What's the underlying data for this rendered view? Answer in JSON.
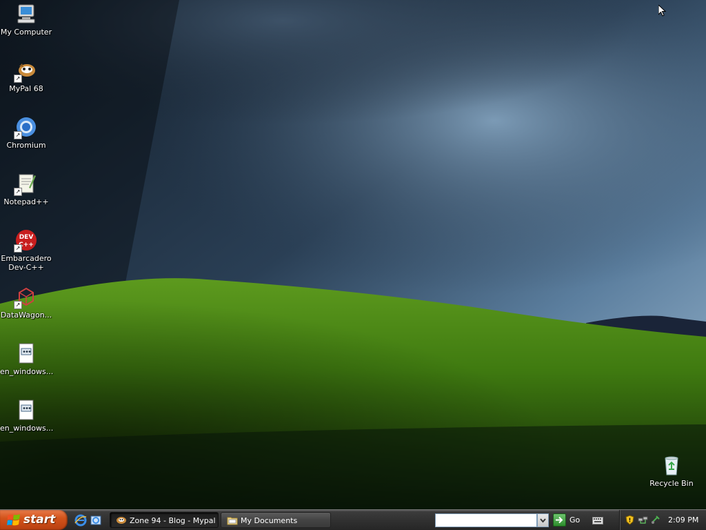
{
  "desktop": {
    "icons": [
      {
        "label": "My Computer",
        "icon": "my-computer-icon",
        "shortcut": false
      },
      {
        "label": "MyPal 68",
        "icon": "mypal-icon",
        "shortcut": true
      },
      {
        "label": "Chromium",
        "icon": "chromium-icon",
        "shortcut": true
      },
      {
        "label": "Notepad++",
        "icon": "notepad-plus-plus-icon",
        "shortcut": true
      },
      {
        "label": "Embarcadero Dev-C++",
        "icon": "dev-cpp-icon",
        "shortcut": true
      },
      {
        "label": "DataWagon...",
        "icon": "datawagon-icon",
        "shortcut": true
      },
      {
        "label": "en_windows...",
        "icon": "iso-file-icon",
        "shortcut": false
      },
      {
        "label": "en_windows...",
        "icon": "iso-file-icon",
        "shortcut": false
      },
      {
        "label": "Recycle Bin",
        "icon": "recycle-bin-icon",
        "shortcut": false
      }
    ]
  },
  "taskbar": {
    "start_label": "start",
    "quick_launch": [
      "internet-explorer-icon",
      "show-desktop-icon"
    ],
    "tasks": [
      {
        "label": "Zone 94 - Blog - Mypal",
        "icon": "mypal-icon",
        "active": true
      },
      {
        "label": "My Documents",
        "icon": "folder-icon",
        "active": false
      }
    ],
    "address_bar": {
      "value": "",
      "go_label": "Go"
    },
    "tray": {
      "icons": [
        "security-shield-icon",
        "network-icon",
        "safely-remove-icon"
      ],
      "clock": "2:09 PM"
    }
  },
  "colors": {
    "start_button": "#d3541b",
    "taskbar": "#2f2f2f",
    "sky": "#1c2a3a",
    "hill": "#3f7a10"
  }
}
